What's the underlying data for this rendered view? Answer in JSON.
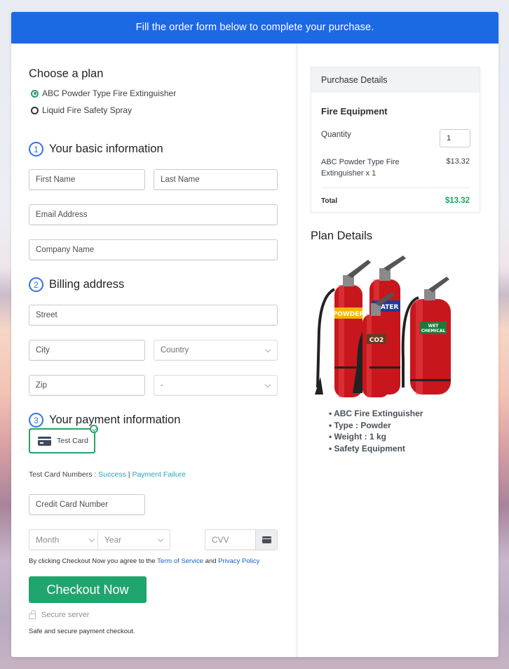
{
  "banner": {
    "text": "Fill the order form below to complete your purchase."
  },
  "plan": {
    "heading": "Choose a plan",
    "options": [
      {
        "label": "ABC Powder Type Fire Extinguisher",
        "selected": true
      },
      {
        "label": "Liquid Fire Safety Spray",
        "selected": false
      }
    ]
  },
  "basic_info": {
    "number": "1",
    "title": "Your basic information",
    "first_name_placeholder": "First Name",
    "last_name_placeholder": "Last Name",
    "email_placeholder": "Email Address",
    "company_placeholder": "Company Name"
  },
  "billing": {
    "number": "2",
    "title": "Billing address",
    "street_placeholder": "Street",
    "city_placeholder": "City",
    "country_select": "Country",
    "zip_placeholder": "Zip",
    "state_select": "-"
  },
  "payment": {
    "number": "3",
    "title": "Your payment information",
    "method_label": "Test Card",
    "test_numbers_label": "Test Card Numbers :",
    "success_link": "Success",
    "separator": "|",
    "failure_link": "Payment Failure",
    "card_number_placeholder": "Credit Card Number",
    "month_select": "Month",
    "year_select": "Year",
    "cvv_placeholder": "CVV"
  },
  "terms": {
    "prefix": "By clicking Checkout Now you agree to the",
    "tos_link": "Term of Service",
    "and": "and",
    "privacy_link": "Privacy Policy"
  },
  "checkout": {
    "button_label": "Checkout Now",
    "secure_label": "Secure server",
    "safe_text": "Safe and secure payment checkout."
  },
  "purchase_details": {
    "header": "Purchase Details",
    "product_title": "Fire Equipment",
    "quantity_label": "Quantity",
    "quantity_value": "1",
    "line_item": "ABC Powder Type Fire Extinguisher x 1",
    "line_price": "$13.32",
    "total_label": "Total",
    "total_value": "$13.32"
  },
  "plan_details": {
    "heading": "Plan Details",
    "image_alt": "Fire extinguishers (Powder, Water, CO2, Wet Chemical)",
    "image_labels": [
      "POWDER",
      "WATER",
      "CO2",
      "WET CHEMICAL"
    ],
    "bullets": [
      "ABC Fire Extinguisher",
      "Type : Powder",
      "Weight : 1 kg",
      "Safety Equipment"
    ]
  },
  "colors": {
    "banner": "#1c69e4",
    "accent_green": "#21a56e",
    "total_green": "#22a565",
    "link_teal": "#1fa7b8",
    "link_blue": "#1c5fc2",
    "step_blue": "#2d74e6"
  }
}
